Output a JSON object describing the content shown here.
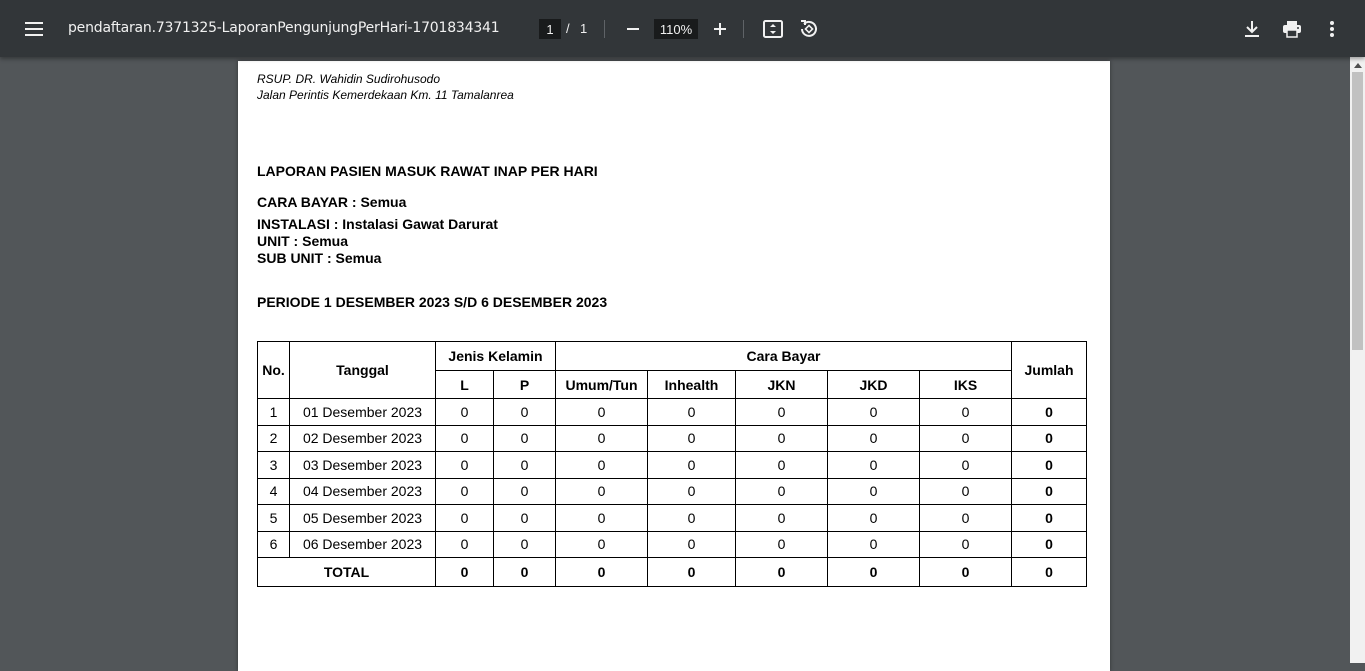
{
  "toolbar": {
    "file_title": "pendaftaran.7371325-LaporanPengunjungPerHari-1701834341",
    "current_page": "1",
    "page_separator": "/",
    "total_pages": "1",
    "zoom": "110%"
  },
  "document": {
    "hospital_name": "RSUP. DR. Wahidin Sudirohusodo",
    "hospital_address": "Jalan Perintis Kemerdekaan Km. 11 Tamalanrea",
    "report_title": "LAPORAN PASIEN MASUK RAWAT INAP PER HARI",
    "cara_bayar": "CARA BAYAR : Semua",
    "instalasi": "INSTALASI : Instalasi Gawat Darurat",
    "unit": "UNIT : Semua",
    "sub_unit": "SUB UNIT : Semua",
    "periode": "PERIODE 1 DESEMBER 2023 S/D 6 DESEMBER 2023"
  },
  "table": {
    "headers": {
      "no": "No.",
      "tanggal": "Tanggal",
      "jenis_kelamin": "Jenis Kelamin",
      "cara_bayar": "Cara Bayar",
      "jumlah": "Jumlah",
      "l": "L",
      "p": "P",
      "umum": "Umum/Tun",
      "inhealth": "Inhealth",
      "jkn": "JKN",
      "jkd": "JKD",
      "iks": "IKS"
    },
    "rows": [
      {
        "no": "1",
        "tanggal": "01 Desember 2023",
        "l": "0",
        "p": "0",
        "umum": "0",
        "inhealth": "0",
        "jkn": "0",
        "jkd": "0",
        "iks": "0",
        "jumlah": "0"
      },
      {
        "no": "2",
        "tanggal": "02 Desember 2023",
        "l": "0",
        "p": "0",
        "umum": "0",
        "inhealth": "0",
        "jkn": "0",
        "jkd": "0",
        "iks": "0",
        "jumlah": "0"
      },
      {
        "no": "3",
        "tanggal": "03 Desember 2023",
        "l": "0",
        "p": "0",
        "umum": "0",
        "inhealth": "0",
        "jkn": "0",
        "jkd": "0",
        "iks": "0",
        "jumlah": "0"
      },
      {
        "no": "4",
        "tanggal": "04 Desember 2023",
        "l": "0",
        "p": "0",
        "umum": "0",
        "inhealth": "0",
        "jkn": "0",
        "jkd": "0",
        "iks": "0",
        "jumlah": "0"
      },
      {
        "no": "5",
        "tanggal": "05 Desember 2023",
        "l": "0",
        "p": "0",
        "umum": "0",
        "inhealth": "0",
        "jkn": "0",
        "jkd": "0",
        "iks": "0",
        "jumlah": "0"
      },
      {
        "no": "6",
        "tanggal": "06 Desember 2023",
        "l": "0",
        "p": "0",
        "umum": "0",
        "inhealth": "0",
        "jkn": "0",
        "jkd": "0",
        "iks": "0",
        "jumlah": "0"
      }
    ],
    "total": {
      "label": "TOTAL",
      "l": "0",
      "p": "0",
      "umum": "0",
      "inhealth": "0",
      "jkn": "0",
      "jkd": "0",
      "iks": "0",
      "jumlah": "0"
    }
  },
  "colors": {
    "toolbar_bg": "#323639",
    "viewer_bg": "#525659",
    "page_bg": "#ffffff"
  },
  "icons": {
    "menu": "hamburger-menu-icon",
    "zoom_out": "minus-icon",
    "zoom_in": "plus-icon",
    "fit": "fit-to-page-icon",
    "rotate": "rotate-icon",
    "download": "download-icon",
    "print": "print-icon",
    "more": "more-vertical-icon"
  }
}
